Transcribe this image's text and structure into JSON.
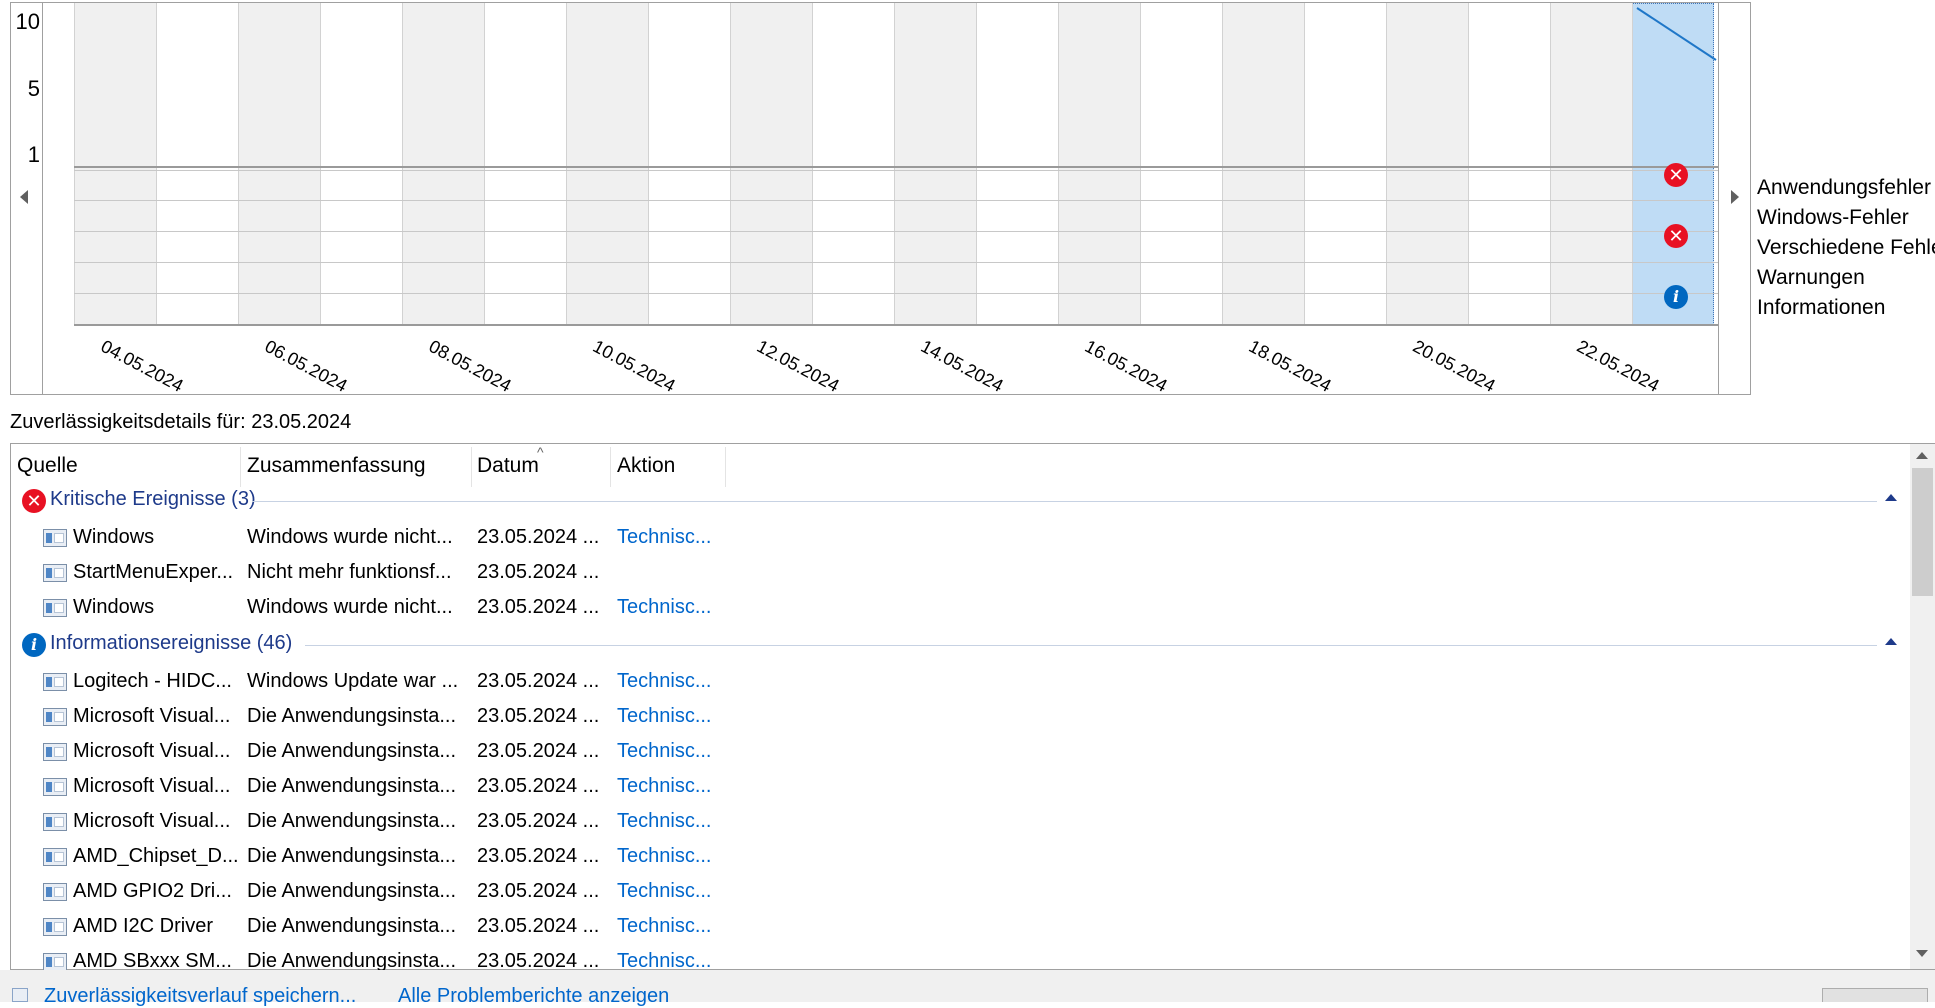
{
  "chart": {
    "y_ticks": [
      "10",
      "5",
      "1"
    ],
    "date_labels": [
      "04.05.2024",
      "06.05.2024",
      "08.05.2024",
      "10.05.2024",
      "12.05.2024",
      "14.05.2024",
      "16.05.2024",
      "18.05.2024",
      "20.05.2024",
      "22.05.2024"
    ],
    "legend": [
      "Anwendungsfehler",
      "Windows-Fehler",
      "Verschiedene Fehler",
      "Warnungen",
      "Informationen"
    ],
    "selected_day": "23.05.2024",
    "stability_index_start": 10,
    "markers": [
      {
        "row": "Anwendungsfehler",
        "type": "error"
      },
      {
        "row": "Verschiedene Fehler",
        "type": "error"
      },
      {
        "row": "Informationen",
        "type": "info"
      }
    ],
    "colors": {
      "selected": "#bfdcf5",
      "error": "#e81123",
      "info": "#0067c0",
      "line": "#1f77c8"
    }
  },
  "details": {
    "title": "Zuverlässigkeitsdetails für: 23.05.2024",
    "columns": [
      "Quelle",
      "Zusammenfassung",
      "Datum",
      "Aktion"
    ],
    "groups": [
      {
        "label": "Kritische Ereignisse (3)",
        "icon": "error-icon",
        "rows": [
          {
            "source": "Windows",
            "summary": "Windows wurde nicht...",
            "date": "23.05.2024 ...",
            "action": "Technisc..."
          },
          {
            "source": "StartMenuExper...",
            "summary": "Nicht mehr funktionsf...",
            "date": "23.05.2024 ...",
            "action": ""
          },
          {
            "source": "Windows",
            "summary": "Windows wurde nicht...",
            "date": "23.05.2024 ...",
            "action": "Technisc..."
          }
        ]
      },
      {
        "label": "Informationsereignisse (46)",
        "icon": "info-icon",
        "rows": [
          {
            "source": "Logitech - HIDC...",
            "summary": "Windows Update war ...",
            "date": "23.05.2024 ...",
            "action": "Technisc..."
          },
          {
            "source": "Microsoft Visual...",
            "summary": "Die Anwendungsinsta...",
            "date": "23.05.2024 ...",
            "action": "Technisc..."
          },
          {
            "source": "Microsoft Visual...",
            "summary": "Die Anwendungsinsta...",
            "date": "23.05.2024 ...",
            "action": "Technisc..."
          },
          {
            "source": "Microsoft Visual...",
            "summary": "Die Anwendungsinsta...",
            "date": "23.05.2024 ...",
            "action": "Technisc..."
          },
          {
            "source": "Microsoft Visual...",
            "summary": "Die Anwendungsinsta...",
            "date": "23.05.2024 ...",
            "action": "Technisc..."
          },
          {
            "source": "AMD_Chipset_D...",
            "summary": "Die Anwendungsinsta...",
            "date": "23.05.2024 ...",
            "action": "Technisc..."
          },
          {
            "source": "AMD GPIO2 Dri...",
            "summary": "Die Anwendungsinsta...",
            "date": "23.05.2024 ...",
            "action": "Technisc..."
          },
          {
            "source": "AMD I2C Driver",
            "summary": "Die Anwendungsinsta...",
            "date": "23.05.2024 ...",
            "action": "Technisc..."
          },
          {
            "source": "AMD SBxxx SM...",
            "summary": "Die Anwendungsinsta...",
            "date": "23.05.2024 ...",
            "action": "Technisc..."
          }
        ]
      }
    ]
  },
  "footer": {
    "save_link": "Zuverlässigkeitsverlauf speichern...",
    "reports_link": "Alle Problemberichte anzeigen"
  }
}
